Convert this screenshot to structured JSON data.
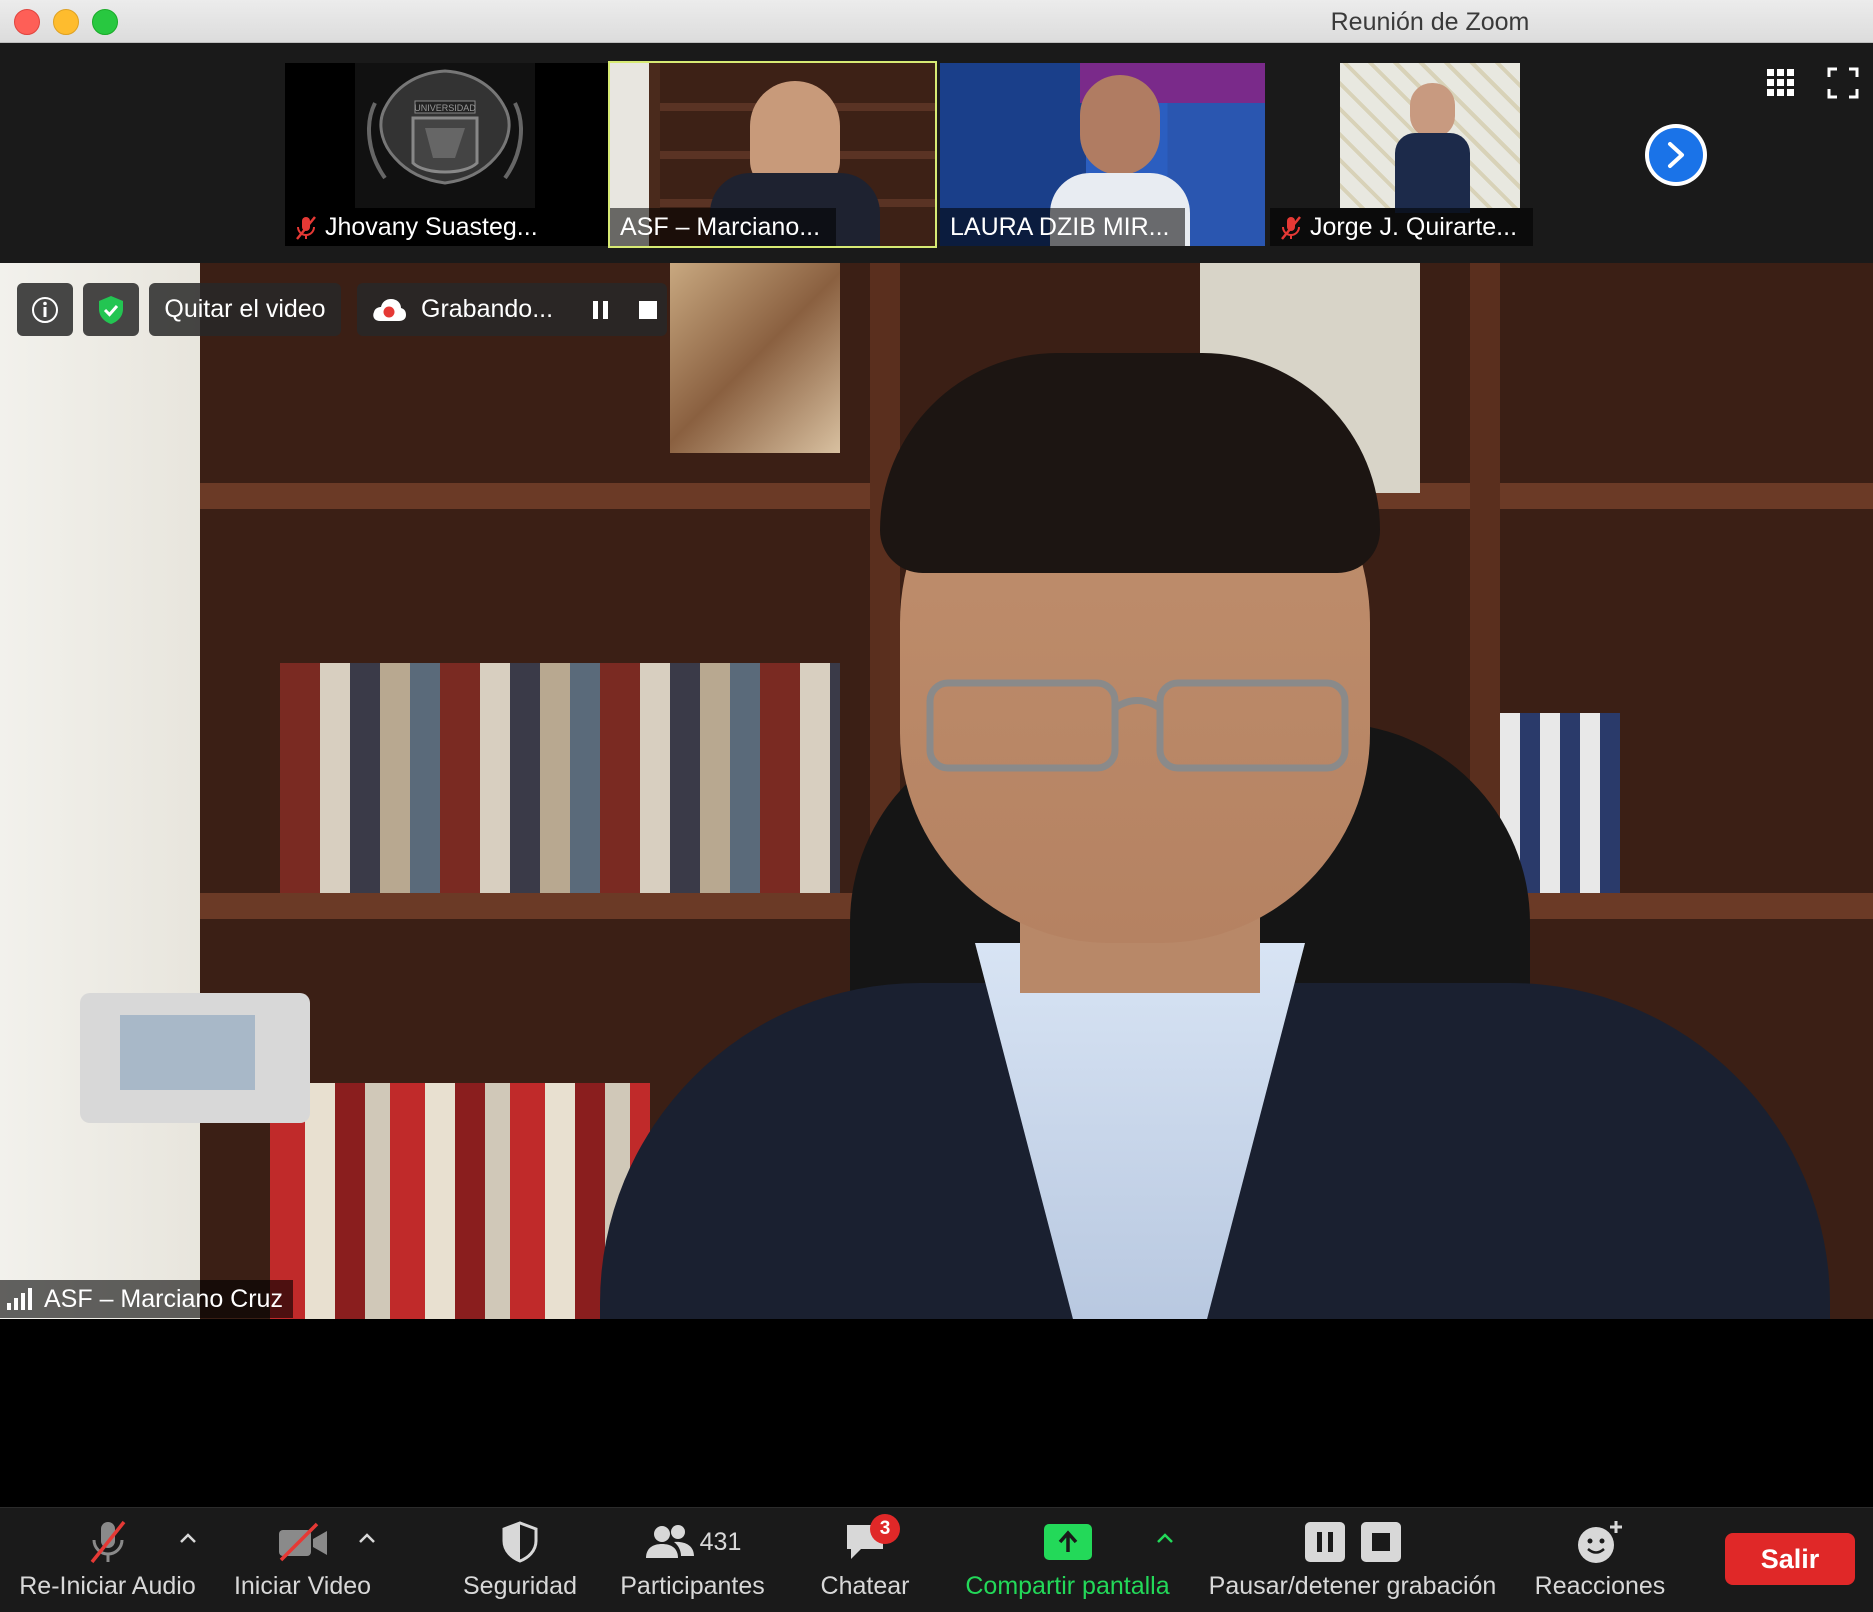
{
  "window": {
    "title": "Reunión de Zoom"
  },
  "thumbnails": [
    {
      "name": "Jhovany Suasteg...",
      "muted": true,
      "logo_text": "UNIVERSIDAD"
    },
    {
      "name": "ASF – Marciano...",
      "muted": false,
      "active": true
    },
    {
      "name": "LAURA DZIB MIR...",
      "muted": false
    },
    {
      "name": "Jorge J. Quirarte...",
      "muted": true
    }
  ],
  "strip_controls": {
    "gallery_icon": "grid-icon",
    "fullscreen_icon": "fullscreen-icon",
    "next_icon": "chevron-right-icon"
  },
  "overlay": {
    "info_icon": "info-icon",
    "security_icon": "shield-check-icon",
    "stop_video_label": "Quitar el video",
    "recording_label": "Grabando...",
    "pause_icon": "pause-icon",
    "stop_icon": "stop-icon"
  },
  "main_speaker": {
    "name": "ASF – Marciano Cruz"
  },
  "toolbar": {
    "audio_label": "Re-Iniciar Audio",
    "video_label": "Iniciar Video",
    "security_label": "Seguridad",
    "participants_label": "Participantes",
    "participants_count": "431",
    "chat_label": "Chatear",
    "chat_badge": "3",
    "share_label": "Compartir pantalla",
    "record_label": "Pausar/detener grabación",
    "reactions_label": "Reacciones",
    "leave_label": "Salir"
  },
  "colors": {
    "share_green": "#23d959",
    "leave_red": "#e02828",
    "active_border": "#d7ea73",
    "next_blue": "#1a73e8"
  }
}
